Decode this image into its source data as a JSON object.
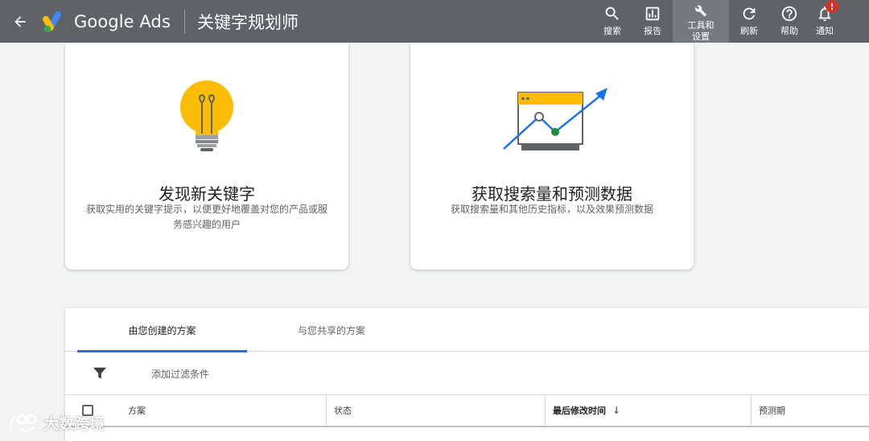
{
  "header": {
    "product_name": "Google Ads",
    "page_title": "关键字规划师",
    "actions": [
      {
        "label": "搜索",
        "icon": "search-icon"
      },
      {
        "label": "报告",
        "icon": "reports-icon"
      },
      {
        "label": "工具和设置",
        "icon": "wrench-icon"
      },
      {
        "label": "刷新",
        "icon": "refresh-icon"
      },
      {
        "label": "帮助",
        "icon": "help-icon"
      },
      {
        "label": "通知",
        "icon": "bell-icon",
        "badge": "!"
      }
    ]
  },
  "cards": [
    {
      "title": "发现新关键字",
      "description": "获取实用的关键字提示，以便更好地覆盖对您的产品或服务感兴趣的用户",
      "icon": "lightbulb-icon"
    },
    {
      "title": "获取搜索量和预测数据",
      "description": "获取搜索量和其他历史指标，以及效果预测数据",
      "icon": "trend-chart-icon"
    }
  ],
  "plans": {
    "tabs": [
      {
        "label": "由您创建的方案",
        "active": true
      },
      {
        "label": "与您共享的方案",
        "active": false
      }
    ],
    "filter_label": "添加过滤条件",
    "columns": [
      {
        "label": "方案"
      },
      {
        "label": "状态"
      },
      {
        "label": "最后修改时间",
        "sorted": "desc"
      },
      {
        "label": "预测期"
      }
    ]
  },
  "watermark": {
    "text": "大数跨境"
  },
  "colors": {
    "header_bg": "#5f6368",
    "accent": "#1a73e8",
    "bulb": "#fbbc04",
    "alert": "#d93025",
    "chart_green": "#1e8e3e"
  }
}
